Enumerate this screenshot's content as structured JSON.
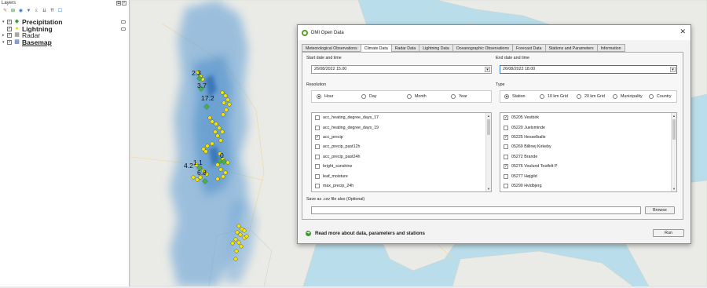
{
  "layers_panel": {
    "title": "Layers",
    "controls": [
      "restore-icon",
      "close-icon"
    ],
    "toolbar_icons": [
      "open-layer-styling-icon",
      "add-group-icon",
      "manage-visibility-icon",
      "filter-legend-icon",
      "filter-expression-icon",
      "expand-all-icon",
      "collapse-all-icon",
      "remove-layer-icon"
    ],
    "layers": [
      {
        "name": "Precipitation",
        "checked": true,
        "bold": true,
        "underline": false,
        "expander": "▾",
        "symbol": "◆",
        "symbol_color": "#3a9a3a"
      },
      {
        "name": "Lightning",
        "checked": true,
        "bold": true,
        "underline": false,
        "expander": "",
        "symbol": "●",
        "symbol_color": "#e0d820"
      },
      {
        "name": "Radar",
        "checked": true,
        "bold": false,
        "underline": false,
        "expander": "▸",
        "symbol": "▦",
        "symbol_color": "#777777"
      },
      {
        "name": "Basemap",
        "checked": true,
        "bold": true,
        "underline": true,
        "expander": "▾",
        "symbol": "▩",
        "symbol_color": "#3b6dc0"
      }
    ]
  },
  "map": {
    "station_values": [
      "2.3",
      "3.7",
      "17.2",
      "0",
      "4.2",
      "1.1",
      "6.8"
    ],
    "precipitation_symbol_color": "#4caf50",
    "lightning_symbol_color": "#f5e400",
    "radar_color": "#5b9bd5",
    "water_color": "#b9ddea",
    "land_color": "#eaebe6"
  },
  "dialog": {
    "title": "DMI Open Data",
    "close_icon": "close-icon",
    "tabs": [
      "Meteorological Observations",
      "Climate Data",
      "Radar Data",
      "Lightning Data",
      "Oceanographic Observations",
      "Forecast Data",
      "Stations and Parameters",
      "Information"
    ],
    "active_tab": "Climate Data",
    "start_label": "Start date and time",
    "start_value": "26/08/2022 15.00",
    "end_label": "End date and time",
    "end_value": "26/08/2022 18.00",
    "resolution_label": "Resolution",
    "resolution_options": [
      {
        "label": "Hour",
        "selected": true
      },
      {
        "label": "Day",
        "selected": false
      },
      {
        "label": "Month",
        "selected": false
      },
      {
        "label": "Year",
        "selected": false
      }
    ],
    "type_label": "Type",
    "type_options": [
      {
        "label": "Station",
        "selected": true
      },
      {
        "label": "10 km Grid",
        "selected": false
      },
      {
        "label": "20 km Grid",
        "selected": false
      },
      {
        "label": "Municipality",
        "selected": false
      },
      {
        "label": "Country",
        "selected": false
      }
    ],
    "parameters": [
      {
        "label": "acc_heating_degree_days_17",
        "checked": false
      },
      {
        "label": "acc_heating_degree_days_19",
        "checked": false
      },
      {
        "label": "acc_precip",
        "checked": true
      },
      {
        "label": "acc_precip_past12h",
        "checked": false
      },
      {
        "label": "acc_precip_past24h",
        "checked": false
      },
      {
        "label": "bright_sunshine",
        "checked": false
      },
      {
        "label": "leaf_moisture",
        "checked": false
      },
      {
        "label": "max_precip_24h",
        "checked": false
      }
    ],
    "stations": [
      {
        "label": "05205 Vestbirk",
        "checked": true
      },
      {
        "label": "05220 Juelsminde",
        "checked": false
      },
      {
        "label": "05225 Hesselballe",
        "checked": true
      },
      {
        "label": "05269 Billinej Kirkeby",
        "checked": false
      },
      {
        "label": "05272 Brande",
        "checked": false
      },
      {
        "label": "05276 Voulund Testfelt P",
        "checked": true
      },
      {
        "label": "05277 Højgild",
        "checked": false
      },
      {
        "label": "05290 Hvidbjerg",
        "checked": false
      }
    ],
    "csv_label": "Save as .csv file also (Optional)",
    "csv_value": "",
    "browse_label": "Browse",
    "read_more": "Read more about data, parameters and stations",
    "run_label": "Run"
  }
}
